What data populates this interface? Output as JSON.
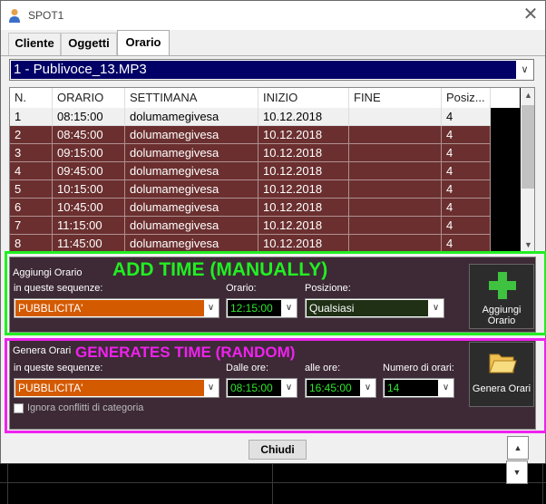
{
  "window": {
    "title": "SPOT1",
    "close_glyph": "✕"
  },
  "tabs": [
    {
      "label": "Cliente",
      "active": false
    },
    {
      "label": "Oggetti",
      "active": false
    },
    {
      "label": "Orario",
      "active": true
    }
  ],
  "file_combo": {
    "value": "1 - Publivoce_13.MP3"
  },
  "grid": {
    "columns": [
      "N.",
      "ORARIO",
      "SETTIMANA",
      "INIZIO",
      "FINE",
      "Posiz..."
    ],
    "rows": [
      [
        "1",
        "08:15:00",
        "dolumamegivesa",
        "10.12.2018",
        "",
        "4"
      ],
      [
        "2",
        "08:45:00",
        "dolumamegivesa",
        "10.12.2018",
        "",
        "4"
      ],
      [
        "3",
        "09:15:00",
        "dolumamegivesa",
        "10.12.2018",
        "",
        "4"
      ],
      [
        "4",
        "09:45:00",
        "dolumamegivesa",
        "10.12.2018",
        "",
        "4"
      ],
      [
        "5",
        "10:15:00",
        "dolumamegivesa",
        "10.12.2018",
        "",
        "4"
      ],
      [
        "6",
        "10:45:00",
        "dolumamegivesa",
        "10.12.2018",
        "",
        "4"
      ],
      [
        "7",
        "11:15:00",
        "dolumamegivesa",
        "10.12.2018",
        "",
        "4"
      ],
      [
        "8",
        "11:45:00",
        "dolumamegivesa",
        "10.12.2018",
        "",
        "4"
      ]
    ]
  },
  "add_section": {
    "title": "Aggiungi Orario",
    "seq_label": "in queste sequenze:",
    "seq_value": "PUBBLICITA'",
    "time_label": "Orario:",
    "time_value": "12:15:00",
    "pos_label": "Posizione:",
    "pos_value": "Qualsiasi",
    "button_label_1": "Aggiungi",
    "button_label_2": "Orario",
    "annotation": "ADD TIME (MANUALLY)",
    "annotation_color": "#22ee22"
  },
  "gen_section": {
    "title": "Genera Orari",
    "seq_label": "in queste sequenze:",
    "seq_value": "PUBBLICITA'",
    "from_label": "Dalle ore:",
    "from_value": "08:15:00",
    "to_label": "alle ore:",
    "to_value": "16:45:00",
    "count_label": "Numero di orari:",
    "count_value": "14",
    "ignore_label": "Ignora conflitti di categoria",
    "button_label": "Genera Orari",
    "annotation": "GENERATES TIME (RANDOM)",
    "annotation_color": "#ee22ee"
  },
  "footer": {
    "close_label": "Chiudi"
  },
  "icons": [
    "user-icon",
    "close-icon",
    "chevron-down-icon",
    "scroll-up-icon",
    "scroll-down-icon",
    "plus-icon",
    "folder-icon",
    "checkbox-icon"
  ]
}
